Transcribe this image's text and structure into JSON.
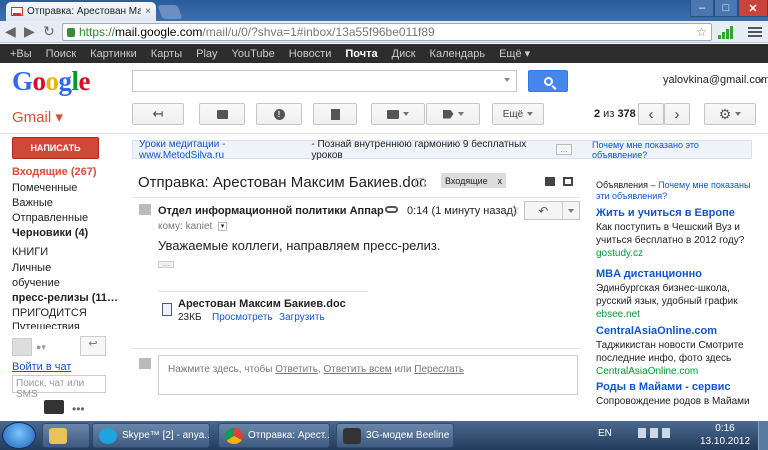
{
  "browser": {
    "tab_title": "Отправка: Арестован Мак",
    "tab_close": "×",
    "url_scheme": "https://",
    "url_host": "mail.google.com",
    "url_path": "/mail/u/0/?shva=1#inbox/13a55f96be011f89",
    "win_min": "–",
    "win_max": "□",
    "win_close": "✕",
    "back": "◀",
    "forward": "▶",
    "reload": "↻"
  },
  "gbar": {
    "items": [
      "+Вы",
      "Поиск",
      "Картинки",
      "Карты",
      "Play",
      "YouTube",
      "Новости",
      "Почта",
      "Диск",
      "Календарь",
      "Ещё ▾"
    ],
    "active_index": 7
  },
  "header": {
    "logo": "Google",
    "logo_colors": [
      "#3369e8",
      "#d50f25",
      "#eeb211",
      "#3369e8",
      "#009925",
      "#d50f25"
    ],
    "account": "yalovkina@gmail.com",
    "gmail_label": "Gmail ▾",
    "more_label": "Ещё",
    "pager": {
      "prefix": "2",
      "sep": " из ",
      "total": "378"
    },
    "prev": "‹",
    "next": "›"
  },
  "nav": {
    "compose": "НАПИСАТЬ",
    "items": [
      {
        "label": "Входящие (267)",
        "style": "red"
      },
      {
        "label": "Помеченные",
        "style": ""
      },
      {
        "label": "Важные",
        "style": ""
      },
      {
        "label": "Отправленные",
        "style": ""
      },
      {
        "label": "Черновики (4)",
        "style": "bold"
      },
      {
        "label": "КНИГИ",
        "style": ""
      },
      {
        "label": "Личные",
        "style": ""
      },
      {
        "label": "обучение",
        "style": ""
      },
      {
        "label": "пресс-релизы (11…",
        "style": "bold"
      },
      {
        "label": "ПРИГОДИТСЯ",
        "style": ""
      },
      {
        "label": "Путешествия",
        "style": ""
      }
    ],
    "chat_signin": "Войти в чат",
    "chat_search_placeholder": "Поиск, чат или SMS",
    "more": "•••"
  },
  "adbar": {
    "link": "Уроки медитации - www.MetodSilva.ru",
    "text": "- Познай внутреннюю гармонию 9 бесплатных уроков",
    "dots": "…",
    "why": "Почему мне показано это объявление?"
  },
  "message": {
    "subject": "Отправка: Арестован Максим Бакиев.doc",
    "chip": "Входящие",
    "chip_x": "x",
    "sender": "Отдел информационной политики Аппар",
    "time": "0:14 (1 минуту назад)",
    "star": "☆",
    "to": "кому: kaniet",
    "body": "Уважаемые коллеги, направляем пресс-релиз.",
    "ellipsis": "…",
    "attachment": {
      "name": "Арестован Максим Бакиев.doc",
      "size": "23КБ",
      "view": "Просмотреть",
      "download": "Загрузить"
    },
    "reply_prompt_prefix": "Нажмите здесь, чтобы ",
    "reply": "Ответить",
    "reply_all": "Ответить всем",
    "or": " или ",
    "forward": "Переслать",
    "sep": ", "
  },
  "ads": {
    "head_label": "Объявления – ",
    "head_link": "Почему мне показаны эти объявления?",
    "items": [
      {
        "title": "Жить и учиться в Европе",
        "desc": "Как поступить в Чешский Вуз и учиться бесплатно в 2012 году?",
        "url": "gostudy.cz"
      },
      {
        "title": "MBA дистанционно",
        "desc": "Эдинбургская бизнес-школа, русский язык, удобный график",
        "url": "ebsee.net"
      },
      {
        "title": "CentralAsiaOnline.com",
        "desc": "Таджикистан новости Смотрите последние инфо, фото здесь",
        "url": "CentralAsiaOnline.com"
      },
      {
        "title": "Роды в Майами - сервис",
        "desc": "Сопровождение родов в Майами",
        "url": ""
      }
    ]
  },
  "taskbar": {
    "items": [
      {
        "id": "tb-explorer",
        "label": ""
      },
      {
        "id": "tb-skype",
        "label": "Skype™ [2] - anya..."
      },
      {
        "id": "tb-chrome",
        "label": "Отправка: Арест..."
      },
      {
        "id": "tb-modem",
        "label": "3G-модем Beeline"
      }
    ],
    "lang": "EN",
    "time": "0:16",
    "date": "13.10.2012"
  }
}
